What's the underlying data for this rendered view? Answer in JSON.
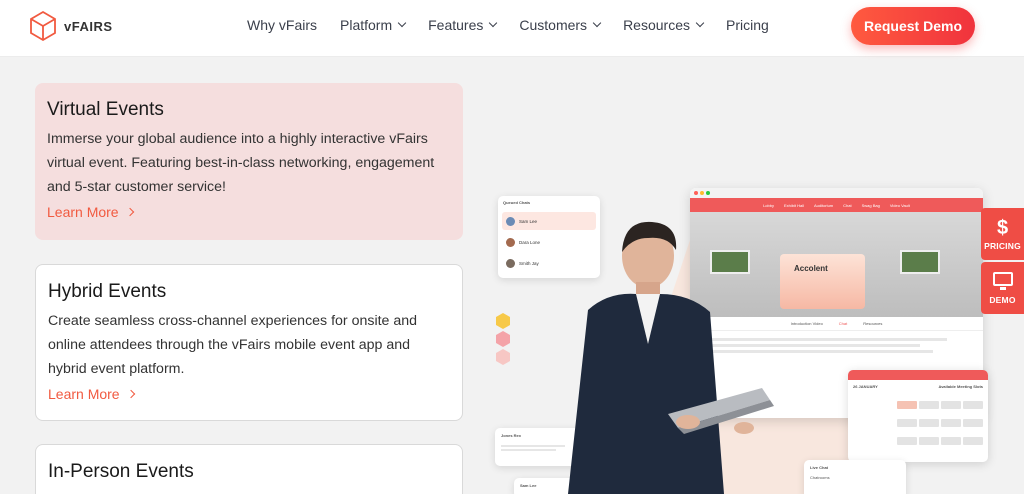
{
  "nav": {
    "logo_text": "vFAIRS",
    "menu": [
      {
        "label": "Why vFairs",
        "has_dropdown": false
      },
      {
        "label": "Platform",
        "has_dropdown": true
      },
      {
        "label": "Features",
        "has_dropdown": true
      },
      {
        "label": "Customers",
        "has_dropdown": true
      },
      {
        "label": "Resources",
        "has_dropdown": true
      },
      {
        "label": "Pricing",
        "has_dropdown": false
      }
    ],
    "cta_label": "Request Demo"
  },
  "cards": [
    {
      "title": "Virtual Events",
      "description": "Immerse your global audience into a highly interactive vFairs virtual event. Featuring best-in-class networking, engagement and 5-star customer service!",
      "link_label": "Learn More"
    },
    {
      "title": "Hybrid Events",
      "description": "Create seamless cross-channel experiences for onsite and online attendees through the vFairs mobile event app and hybrid event platform.",
      "link_label": "Learn More"
    },
    {
      "title": "In-Person Events"
    }
  ],
  "illustration": {
    "queued_title": "Queued Chats",
    "queued_chats": [
      "Sam Lee",
      "Dara Lone",
      "Smith Jay"
    ],
    "app_tabs": [
      "Lobby",
      "Exhibit Hall",
      "Auditorium",
      "Chat",
      "Swag Bag",
      "Video Vault"
    ],
    "booth_name": "Accolent",
    "booth_tabs": [
      "Introduction Video",
      "Chat",
      "Resources"
    ],
    "meeting_title": "Reserve Meeting",
    "meeting_date": "26 JANUARY",
    "meeting_subtitle": "Available Meeting Slots",
    "live_chat_title": "Live Chat",
    "live_chat_sub": "Chatrooms",
    "chat_bubble_name": "Jones Rex",
    "chat_bubble_name2": "Sam Lee"
  },
  "side_buttons": {
    "pricing_icon": "$",
    "pricing_label": "PRICING",
    "demo_icon": "monitor-icon",
    "demo_label": "DEMO"
  },
  "colors": {
    "accent": "#f15a40",
    "cta": "#f0333d",
    "active_card": "#f5dede",
    "side_button": "#ef4d45"
  }
}
